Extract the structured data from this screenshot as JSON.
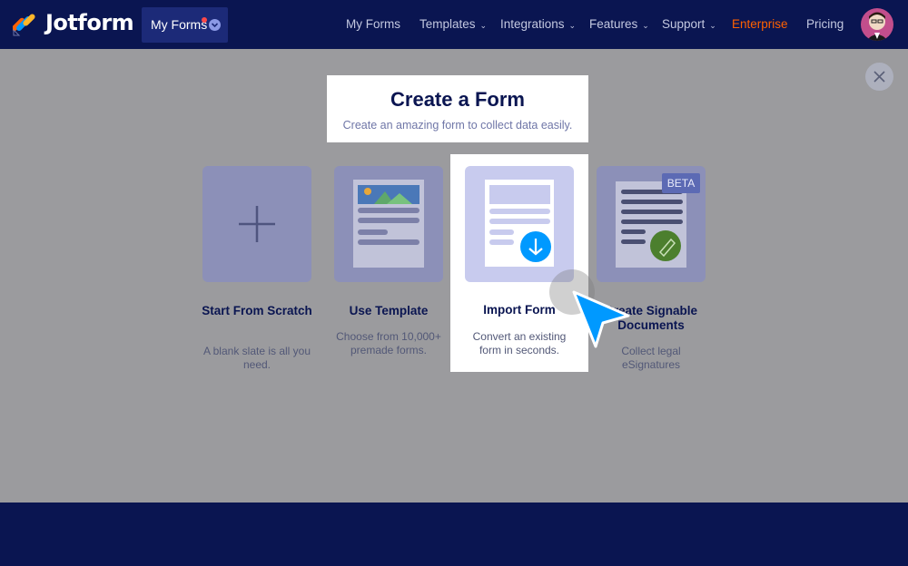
{
  "nav": {
    "logo_text": "Jotform",
    "my_forms_button": "My Forms",
    "items": [
      {
        "label": "My Forms",
        "has_dropdown": false
      },
      {
        "label": "Templates",
        "has_dropdown": true
      },
      {
        "label": "Integrations",
        "has_dropdown": true
      },
      {
        "label": "Features",
        "has_dropdown": true
      },
      {
        "label": "Support",
        "has_dropdown": true
      },
      {
        "label": "Enterprise",
        "has_dropdown": false
      },
      {
        "label": "Pricing",
        "has_dropdown": false
      }
    ],
    "dropdown_caret": "⌄"
  },
  "modal": {
    "title": "Create a Form",
    "subtitle": "Create an amazing form to collect data easily."
  },
  "cards": [
    {
      "title": "Start From Scratch",
      "desc": "A blank slate is all you need."
    },
    {
      "title": "Use Template",
      "desc": "Choose from 10,000+ premade forms."
    },
    {
      "title": "Import Form",
      "desc": "Convert an existing form in seconds."
    },
    {
      "title": "Create Signable Documents",
      "desc": "Collect legal eSignatures",
      "badge": "BETA"
    }
  ],
  "colors": {
    "navy": "#0a1551",
    "enterprise": "#ff6100",
    "overlay": "#9b9b9e",
    "cursor": "#0099ff"
  }
}
